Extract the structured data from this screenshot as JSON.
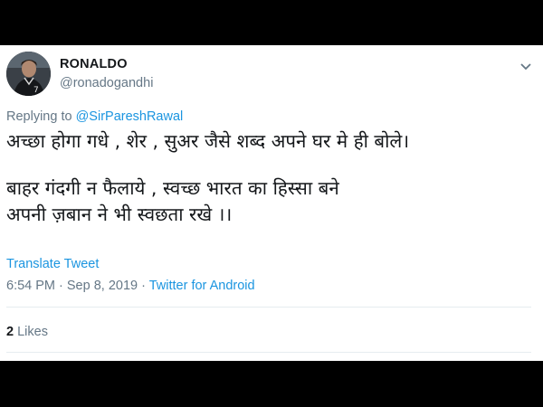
{
  "tweet": {
    "author": {
      "display_name": "RONALDO",
      "handle": "@ronadogandhi",
      "avatar_number": "7"
    },
    "reply": {
      "prefix": "Replying to",
      "mention": "@SirPareshRawal"
    },
    "text": {
      "para1_line1": "अच्छा होगा गधे , शेर , सुअर जैसे शब्द अपने घर मे ही बोले।",
      "para2_line1": "बाहर गंदगी न फैलाये , स्वच्छ भारत का हिस्सा बने",
      "para2_line2": "अपनी ज़बान ने भी स्वछता रखे ।।"
    },
    "translate_label": "Translate Tweet",
    "timestamp": "6:54 PM · Sep 8, 2019",
    "separator": " · ",
    "source": "Twitter for Android",
    "likes": {
      "count": "2",
      "label": "Likes"
    }
  },
  "colors": {
    "link": "#1b95e0",
    "secondary_text": "#657786",
    "primary_text": "#14171a",
    "letterbox": "#000000"
  },
  "icons": {
    "more": "chevron-down-icon"
  }
}
